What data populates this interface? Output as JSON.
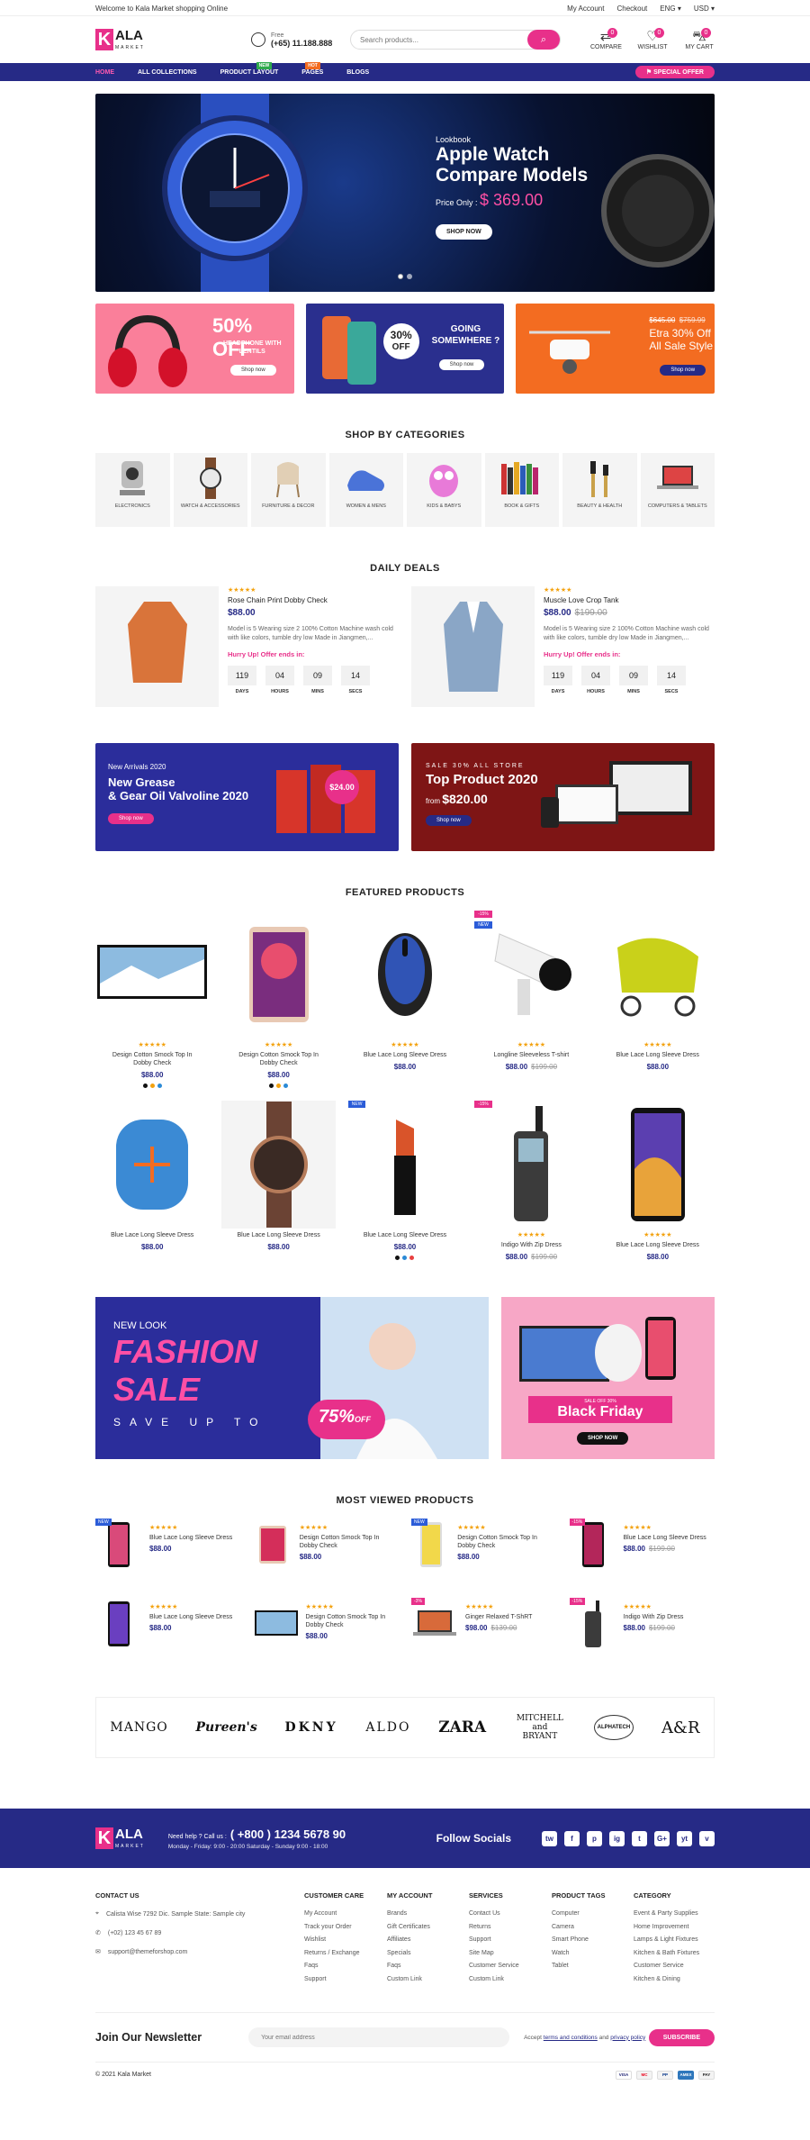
{
  "topbar": {
    "welcome": "Welcome to Kala Market shopping Online",
    "my_account": "My Account",
    "checkout": "Checkout",
    "lang": "ENG",
    "currency": "USD"
  },
  "header": {
    "logo_main": "ALA",
    "logo_sub": "MARKET",
    "logo_letter": "K",
    "phone_label": "Free",
    "phone": "(+65) 11.188.888",
    "search_placeholder": "Search products...",
    "compare": "COMPARE",
    "compare_count": "0",
    "wishlist": "WISHLIST",
    "wishlist_count": "0",
    "cart": "MY CART",
    "cart_count": "0"
  },
  "nav": {
    "items": [
      "HOME",
      "ALL COLLECTIONS",
      "PRODUCT LAYOUT",
      "PAGES",
      "BLOGS"
    ],
    "new_tag": "NEW",
    "hot_tag": "HOT",
    "offer": "SPECIAL OFFER"
  },
  "hero": {
    "kicker": "Lookbook",
    "title1": "Apple Watch",
    "title2": "Compare Models",
    "price_label": "Price Only :",
    "price": "$ 369.00",
    "cta": "SHOP NOW"
  },
  "banners": {
    "b1": {
      "big": "50% OFF",
      "sub1": "HEADPHONE WITH",
      "sub2": "LENTILS",
      "cta": "Shop now"
    },
    "b2": {
      "pct": "30%",
      "off": "OFF",
      "t1": "GOING",
      "t2": "SOMEWHERE ?",
      "cta": "Shop now"
    },
    "b3": {
      "old1": "$645.00",
      "old2": "$759.99",
      "t1": "Etra 30% Off",
      "t2": "All Sale Style",
      "cta": "Shop now"
    }
  },
  "categories": {
    "title": "SHOP BY CATEGORIES",
    "items": [
      "ELECTRONICS",
      "WATCH & ACCESSORIES",
      "FURNITURE & DECOR",
      "WOMEN & MENS",
      "KIDS & BABYS",
      "BOOK & GIFTS",
      "BEAUTY & HEALTH",
      "COMPUTERS & TABLETS"
    ]
  },
  "deals": {
    "title": "DAILY DEALS",
    "hurry": "Hurry Up! Offer ends in:",
    "labels": [
      "DAYS",
      "HOURS",
      "MINS",
      "SECS"
    ],
    "items": [
      {
        "name": "Rose Chain Print Dobby Check",
        "price": "$88.00",
        "old": "",
        "desc": "Model is 5 Wearing size 2 100% Cotton Machine wash cold with like colors, tumble dry low Made in Jiangmen,...",
        "timer": [
          "119",
          "04",
          "09",
          "14"
        ]
      },
      {
        "name": "Muscle Love Crop Tank",
        "price": "$88.00",
        "old": "$199.00",
        "desc": "Model is 5 Wearing size 2 100% Cotton Machine wash cold with like colors, tumble dry low Made in Jiangmen,...",
        "timer": [
          "119",
          "04",
          "09",
          "14"
        ]
      }
    ]
  },
  "promo": {
    "left": {
      "kicker": "New Arrivals 2020",
      "t1": "New Grease",
      "t2": "& Gear Oil Valvoline 2020",
      "tag": "$24.00",
      "cta": "Shop now"
    },
    "right": {
      "kicker": "SALE 30% ALL STORE",
      "t1": "Top Product 2020",
      "from": "from",
      "price": "$820.00",
      "cta": "Shop now"
    }
  },
  "featured": {
    "title": "FEATURED PRODUCTS",
    "items": [
      {
        "name": "Design Cotton Smock Top In Dobby Check",
        "price": "$88.00",
        "old": "",
        "label": "",
        "sw": true
      },
      {
        "name": "Design Cotton Smock Top In Dobby Check",
        "price": "$88.00",
        "old": "",
        "label": "",
        "sw": true
      },
      {
        "name": "Blue Lace Long Sleeve Dress",
        "price": "$88.00",
        "old": "",
        "label": "",
        "sw": false
      },
      {
        "name": "Longline Sleeveless T-shirt",
        "price": "$88.00",
        "old": "$199.00",
        "label": "-15%",
        "label2": "NEW",
        "sw": false
      },
      {
        "name": "Blue Lace Long Sleeve Dress",
        "price": "$88.00",
        "old": "",
        "label": "",
        "sw": false
      },
      {
        "name": "Blue Lace Long Sleeve Dress",
        "price": "$88.00",
        "old": "",
        "label": "",
        "sw": false
      },
      {
        "name": "Blue Lace Long Sleeve Dress",
        "price": "$88.00",
        "old": "",
        "label": "",
        "sw": false
      },
      {
        "name": "Blue Lace Long Sleeve Dress",
        "price": "$88.00",
        "old": "",
        "label": "NEW",
        "sw": true
      },
      {
        "name": "Indigo With Zip Dress",
        "price": "$88.00",
        "old": "$199.00",
        "label": "-15%",
        "sw": false
      },
      {
        "name": "Blue Lace Long Sleeve Dress",
        "price": "$88.00",
        "old": "",
        "label": "",
        "sw": false
      }
    ]
  },
  "fashion": {
    "kicker": "NEW LOOK",
    "t1": "FASHION",
    "t2": "SALE",
    "save": "SAVE UP TO",
    "pct": "75%",
    "off": "OFF",
    "bf_small": "SALE OFF 30%",
    "bf": "Black Friday",
    "bf_cta": "SHOP NOW"
  },
  "most_viewed": {
    "title": "MOST VIEWED PRODUCTS",
    "items": [
      {
        "name": "Blue Lace Long Sleeve Dress",
        "price": "$88.00",
        "old": "",
        "label": "NEW"
      },
      {
        "name": "Design Cotton Smock Top In Dobby Check",
        "price": "$88.00",
        "old": "",
        "label": ""
      },
      {
        "name": "Design Cotton Smock Top In Dobby Check",
        "price": "$88.00",
        "old": "",
        "label": "NEW"
      },
      {
        "name": "Blue Lace Long Sleeve Dress",
        "price": "$88.00",
        "old": "$199.00",
        "label": "-15%"
      },
      {
        "name": "Blue Lace Long Sleeve Dress",
        "price": "$88.00",
        "old": "",
        "label": ""
      },
      {
        "name": "Design Cotton Smock Top In Dobby Check",
        "price": "$88.00",
        "old": "",
        "label": ""
      },
      {
        "name": "Ginger Relaxed T-ShRT",
        "price": "$98.00",
        "old": "$139.00",
        "label": "-3%"
      },
      {
        "name": "Indigo With Zip Dress",
        "price": "$88.00",
        "old": "$199.00",
        "label": "-15%"
      }
    ]
  },
  "brands": [
    "MANGO",
    "Pureen's",
    "DKNY",
    "ALDO",
    "ZARA",
    "MITCHELL and BRYANT",
    "ALPHATECH",
    "A&R"
  ],
  "footer_bar": {
    "help": "Need help ? Call us :",
    "phone": "( +800 ) 1234 5678 90",
    "hours": "Monday - Friday: 9:00 - 20:00 Saturday - Sunday 9:00 - 18:00",
    "follow": "Follow Socials",
    "socials": [
      "tw",
      "f",
      "p",
      "ig",
      "t",
      "G+",
      "yt",
      "v"
    ]
  },
  "footer_cols": [
    {
      "title": "CONTACT US",
      "items": [
        "Calista Wise 7292 Dic. Sample State: Sample city",
        "(+02) 123 45 67 89",
        "support@themeforshop.com"
      ]
    },
    {
      "title": "CUSTOMER CARE",
      "items": [
        "My Account",
        "Track your Order",
        "Wishlist",
        "Returns / Exchange",
        "Faqs",
        "Support"
      ]
    },
    {
      "title": "MY ACCOUNT",
      "items": [
        "Brands",
        "Gift Certificates",
        "Affiliates",
        "Specials",
        "Faqs",
        "Custom Link"
      ]
    },
    {
      "title": "SERVICES",
      "items": [
        "Contact Us",
        "Returns",
        "Support",
        "Site Map",
        "Customer Service",
        "Custom Link"
      ]
    },
    {
      "title": "PRODUCT TAGS",
      "items": [
        "Computer",
        "Camera",
        "Smart Phone",
        "Watch",
        "Tablet"
      ]
    },
    {
      "title": "CATEGORY",
      "items": [
        "Event & Party Supplies",
        "Home Improvement",
        "Lamps & Light Fixtures",
        "Kitchen & Bath Fixtures",
        "Customer Service",
        "Kitchen & Dining"
      ]
    }
  ],
  "newsletter": {
    "title": "Join Our Newsletter",
    "placeholder": "Your email address",
    "agree1": "Accept",
    "agree_terms": "terms and conditions",
    "agree2": "and",
    "agree_privacy": "privacy policy",
    "cta": "SUBSCRIBE"
  },
  "copyright": "© 2021 Kala Market",
  "payments": [
    "VISA",
    "MC",
    "PP",
    "AMEX",
    "PAY"
  ],
  "colors": {
    "accent": "#e8308a",
    "navy": "#262a86",
    "star": "#f3a20f"
  }
}
